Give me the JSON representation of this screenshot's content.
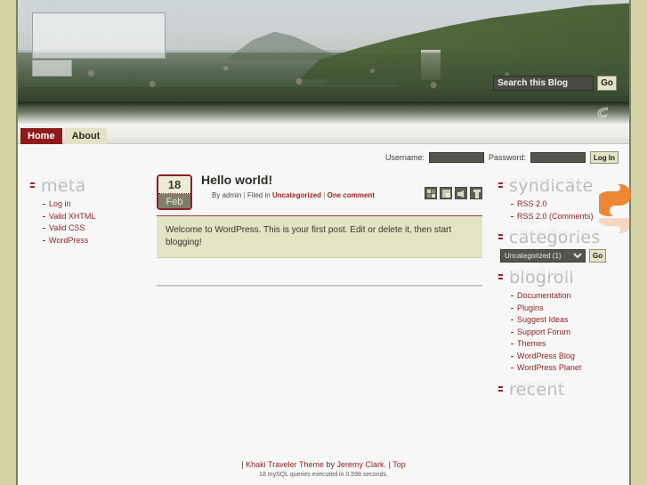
{
  "site": {
    "title": "",
    "tagline": ""
  },
  "search": {
    "placeholder": "Search this Blog",
    "value": "",
    "go_label": "Go"
  },
  "nav": {
    "items": [
      {
        "label": "Home",
        "current": true
      },
      {
        "label": "About",
        "current": false
      }
    ]
  },
  "login": {
    "username_label": "Username:",
    "username_value": "",
    "password_label": "Password:",
    "password_value": "",
    "submit_label": "Log In"
  },
  "sidebar_left": {
    "widgets": [
      {
        "title": "meta",
        "items": [
          "Log in",
          "Valid XHTML",
          "Valid CSS",
          "WordPress"
        ]
      }
    ]
  },
  "post": {
    "day": "18",
    "month": "Feb",
    "title": "Hello world!",
    "meta": {
      "by": "By admin",
      "sep1": "|",
      "filed_in": "Filed in",
      "category": "Uncategorized",
      "sep2": "|",
      "comments": "One comment"
    },
    "body": "Welcome to WordPress. This is your first post. Edit or delete it, then start blogging!",
    "social_icons": [
      "delicious-icon",
      "stumbleupon-icon",
      "speaker-icon",
      "share-icon"
    ]
  },
  "sidebar_right": {
    "widgets": [
      {
        "title": "syndicate",
        "type": "links",
        "items": [
          "RSS 2.0",
          "RSS 2.0 (Comments)"
        ]
      },
      {
        "title": "categories",
        "type": "select",
        "selected": "Uncategorized  (1)",
        "options": [
          "Uncategorized  (1)"
        ],
        "go_label": "Go"
      },
      {
        "title": "blogroll",
        "type": "links",
        "items": [
          "Documentation",
          "Plugins",
          "Suggest Ideas",
          "Support Forum",
          "Themes",
          "WordPress Blog",
          "WordPress Planet"
        ]
      },
      {
        "title": "recent",
        "type": "links",
        "items": []
      }
    ],
    "rss_icon": "rss-feed-icon"
  },
  "footer": {
    "prefix": "|",
    "theme_link": "Khaki Traveler Theme",
    "by": "by",
    "author": "Jeremy Clark",
    "period": ".",
    "sep": "|",
    "top_link": "Top",
    "queries": "18 mySQL queries executed in 0.598 seconds."
  },
  "colors": {
    "page_bg": "#d4d4a6",
    "frame_bg": "#f7f7f7",
    "accent_red": "#8e2020",
    "nav_current_bg": "#8e1919",
    "nav_page_bg": "#e2e2c4",
    "post_body_bg": "#e3e3c6",
    "heading_gray": "#b9b9b9",
    "rss_orange": "#ed8733",
    "button_bg": "#e4e4c9",
    "input_bg": "#4a4a46"
  }
}
